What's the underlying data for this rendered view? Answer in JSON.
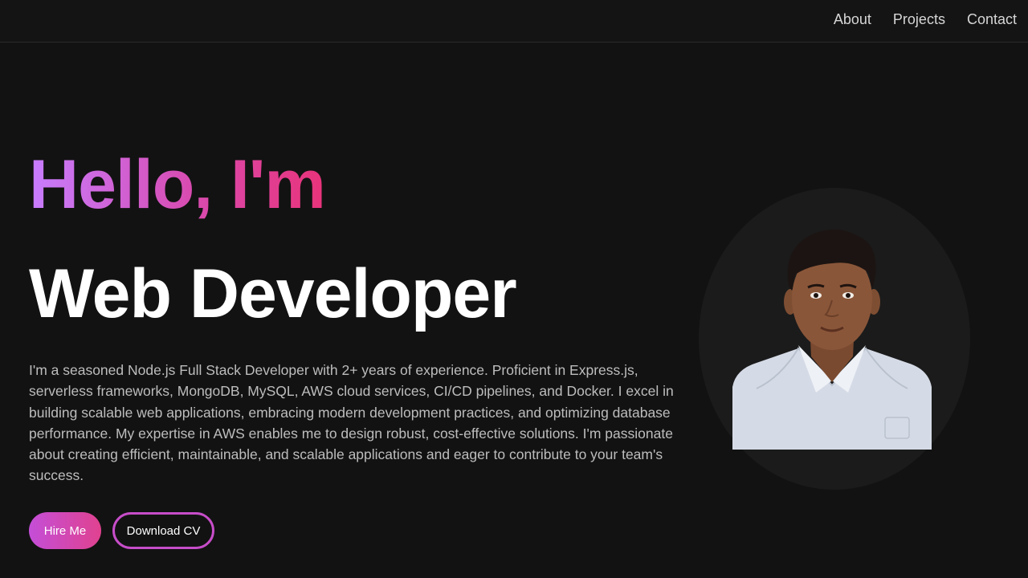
{
  "nav": {
    "about": "About",
    "projects": "Projects",
    "contact": "Contact"
  },
  "hero": {
    "greeting": "Hello, I'm",
    "role": "Web Developer",
    "bio": "I'm a seasoned Node.js Full Stack Developer with 2+ years of experience. Proficient in Express.js, serverless frameworks, MongoDB, MySQL, AWS cloud services, CI/CD pipelines, and Docker. I excel in building scalable web applications, embracing modern development practices, and optimizing database performance. My expertise in AWS enables me to design robust, cost-effective solutions. I'm passionate about creating efficient, maintainable, and scalable applications and eager to contribute to your team's success.",
    "hire_label": "Hire Me",
    "download_label": "Download CV"
  },
  "colors": {
    "background": "#121212",
    "gradient_start": "#c77dff",
    "gradient_end": "#e8337a",
    "body_text": "#bdbdbd"
  }
}
